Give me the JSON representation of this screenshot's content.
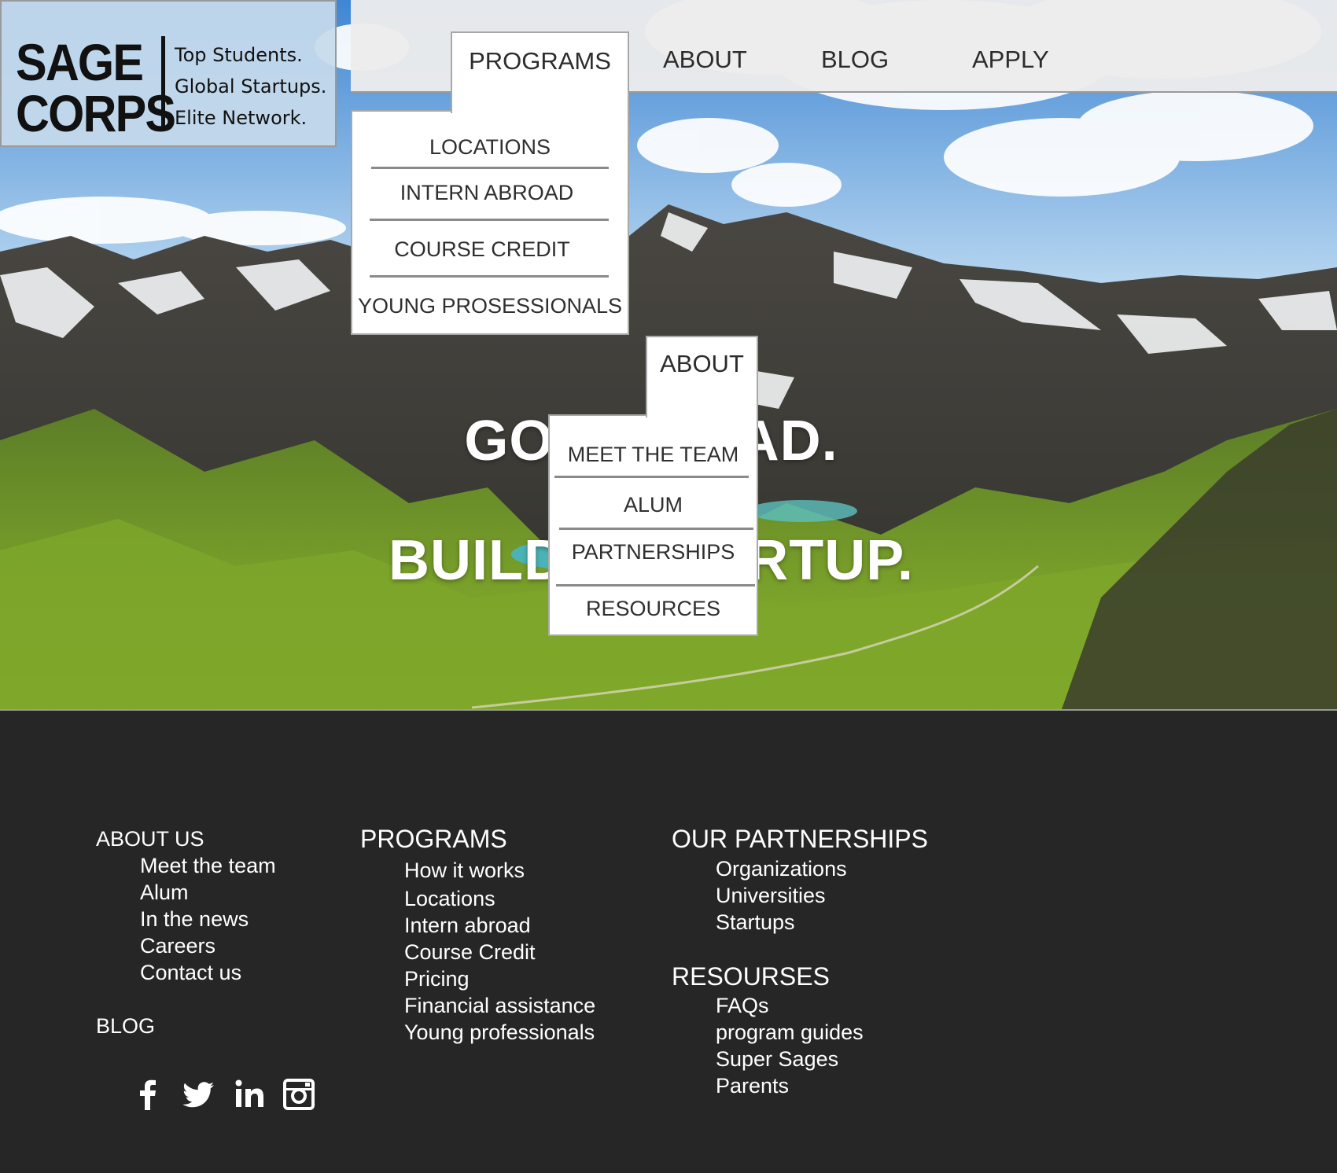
{
  "header": {
    "logo": {
      "word_1": "SAGE",
      "word_2": "CORPS"
    },
    "tagline": [
      "Top Students.",
      "Global Startups.",
      "Elite Network."
    ],
    "nav": {
      "programs": "PROGRAMS",
      "about": "ABOUT",
      "blog": "BLOG",
      "apply": "APPLY"
    }
  },
  "programs_menu": {
    "label": "PROGRAMS",
    "items": [
      "LOCATIONS",
      "INTERN ABROAD",
      "COURSE CREDIT",
      "YOUNG PROSESSIONALS"
    ]
  },
  "about_menu": {
    "label": "ABOUT",
    "items": [
      "MEET THE TEAM",
      "ALUM",
      "PARTNERSHIPS",
      "RESOURCES"
    ]
  },
  "hero": {
    "line_1": "GO ABROAD.",
    "line_2": "BUILD A STARTUP."
  },
  "footer": {
    "about": {
      "heading": "ABOUT US",
      "links": [
        "Meet the team",
        "Alum",
        "In the news",
        "Careers",
        "Contact us"
      ]
    },
    "blog": "BLOG",
    "programs": {
      "heading": "PROGRAMS",
      "links": [
        "How it works",
        "Locations",
        "Intern abroad",
        "Course Credit",
        "Pricing",
        "Financial assistance",
        "Young professionals"
      ]
    },
    "partnerships": {
      "heading": "OUR PARTNERSHIPS",
      "links": [
        "Organizations",
        "Universities",
        "Startups"
      ]
    },
    "resources": {
      "heading": "RESOURSES",
      "links": [
        "FAQs",
        "program guides",
        "Super Sages",
        "Parents"
      ]
    },
    "social": [
      "facebook-icon",
      "twitter-icon",
      "linkedin-icon",
      "instagram-icon"
    ]
  },
  "colors": {
    "footer_bg": "#262626",
    "nav_bg": "#ececec",
    "logo_bg": "#c6daec",
    "text_dark": "#2c2c2c"
  }
}
